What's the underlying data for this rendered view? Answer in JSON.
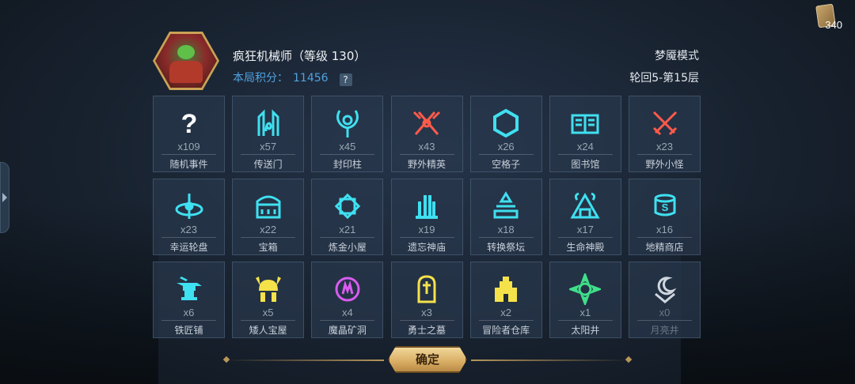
{
  "corner": {
    "card_count": "340"
  },
  "header": {
    "hero_name": "疯狂机械师（等级 130）",
    "score_label": "本局积分：",
    "score_value": "11456",
    "help": "?",
    "mode": "梦魇模式",
    "cycle": "轮回5-第15层"
  },
  "tiles": [
    {
      "count": "x109",
      "label": "随机事件",
      "icon": "question-icon",
      "color": "#ffffff"
    },
    {
      "count": "x57",
      "label": "传送门",
      "icon": "portal-icon",
      "color": "#3fe0f0"
    },
    {
      "count": "x45",
      "label": "封印柱",
      "icon": "seal-pillar-icon",
      "color": "#3fe0f0"
    },
    {
      "count": "x43",
      "label": "野外精英",
      "icon": "crossed-axes-icon",
      "color": "#ff5a4a"
    },
    {
      "count": "x26",
      "label": "空格子",
      "icon": "hexagon-icon",
      "color": "#3fe0f0"
    },
    {
      "count": "x24",
      "label": "图书馆",
      "icon": "book-icon",
      "color": "#3fe0f0"
    },
    {
      "count": "x23",
      "label": "野外小怪",
      "icon": "crossed-swords-icon",
      "color": "#ff5a4a"
    },
    {
      "count": "x23",
      "label": "幸运轮盘",
      "icon": "wheel-icon",
      "color": "#3fe0f0"
    },
    {
      "count": "x22",
      "label": "宝箱",
      "icon": "chest-icon",
      "color": "#3fe0f0"
    },
    {
      "count": "x21",
      "label": "炼金小屋",
      "icon": "alchemy-icon",
      "color": "#3fe0f0"
    },
    {
      "count": "x19",
      "label": "遗忘神庙",
      "icon": "temple-icon",
      "color": "#3fe0f0"
    },
    {
      "count": "x18",
      "label": "转换祭坛",
      "icon": "altar-icon",
      "color": "#3fe0f0"
    },
    {
      "count": "x17",
      "label": "生命神殿",
      "icon": "shrine-icon",
      "color": "#3fe0f0"
    },
    {
      "count": "x16",
      "label": "地精商店",
      "icon": "goblin-shop-icon",
      "color": "#3fe0f0"
    },
    {
      "count": "x6",
      "label": "铁匠铺",
      "icon": "anvil-icon",
      "color": "#3fe0f0"
    },
    {
      "count": "x5",
      "label": "矮人宝屋",
      "icon": "dwarf-helmet-icon",
      "color": "#f5e24a"
    },
    {
      "count": "x4",
      "label": "魔晶矿洞",
      "icon": "crystal-mine-icon",
      "color": "#d85cf0"
    },
    {
      "count": "x3",
      "label": "勇士之墓",
      "icon": "tomb-icon",
      "color": "#f5e24a"
    },
    {
      "count": "x2",
      "label": "冒险者仓库",
      "icon": "warehouse-icon",
      "color": "#f5e24a"
    },
    {
      "count": "x1",
      "label": "太阳井",
      "icon": "sun-well-icon",
      "color": "#3fe08a"
    },
    {
      "count": "x0",
      "label": "月亮井",
      "icon": "moon-well-icon",
      "color": "#cfd6de"
    }
  ],
  "footer": {
    "confirm_label": "确定"
  }
}
